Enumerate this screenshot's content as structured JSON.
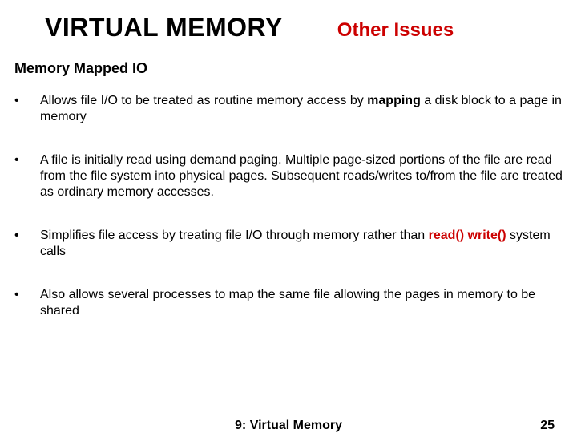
{
  "header": {
    "title": "VIRTUAL MEMORY",
    "subtitle": "Other Issues"
  },
  "section_heading": "Memory Mapped IO",
  "bullets": {
    "b1": {
      "pre": "Allows file I/O to be treated as routine memory access by ",
      "bold": "mapping",
      "post": " a disk block to a page in memory"
    },
    "b2": "A file is initially read using demand paging. Multiple page-sized portions of the file are read from the file system into physical pages. Subsequent reads/writes to/from the file are treated as ordinary memory accesses.",
    "b3": {
      "pre": "Simplifies file access by treating file I/O through memory rather than ",
      "code": "read() write()",
      "post": " system calls"
    },
    "b4": "Also allows several processes to map the same file allowing the pages in memory to be shared"
  },
  "footer": {
    "title": "9: Virtual Memory",
    "page": "25"
  }
}
